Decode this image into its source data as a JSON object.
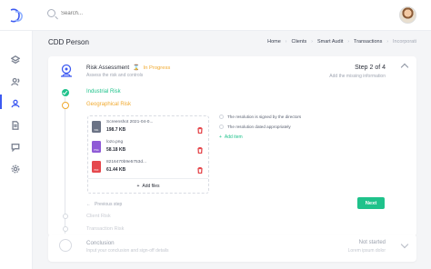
{
  "search": {
    "placeholder": "Search..."
  },
  "sidebar": {
    "items": [
      {
        "icon": "layers-icon"
      },
      {
        "icon": "users-icon"
      },
      {
        "icon": "user-icon",
        "active": true
      },
      {
        "icon": "document-icon"
      },
      {
        "icon": "chat-icon"
      },
      {
        "icon": "settings-icon"
      }
    ]
  },
  "header": {
    "title": "CDD Person",
    "breadcrumb": [
      "Home",
      "Clients",
      "Smart Audit",
      "Transactions",
      "Incorporati"
    ]
  },
  "risk": {
    "title": "Risk Assessment",
    "status": "In Progress",
    "subtitle": "Assess the risk and controls",
    "step_count": "Step 2 of 4",
    "step_desc": "Add the missing information"
  },
  "sections": {
    "done": "Industrial Risk",
    "current": "Geographical Risk",
    "pending": [
      "Client Risk",
      "Transaction Risk"
    ]
  },
  "files": [
    {
      "name": "Screenshot 2021-04-0...",
      "size": "198.7 KB",
      "type": "IMG",
      "color": "#6b7385"
    },
    {
      "name": "lozo.png",
      "size": "58.18 KB",
      "type": "PNG",
      "color": "#8f5bd6"
    },
    {
      "name": "8216470b9e5753d...",
      "size": "61.44 KB",
      "type": "PDF",
      "color": "#e5484d"
    }
  ],
  "add_files_label": "Add files",
  "checklist": [
    "The resolution is signed by the directors",
    "The resolution dated appropriately"
  ],
  "add_item_label": "Add item",
  "prev_step_label": "Previous step",
  "next_label": "Next",
  "conclusion": {
    "title": "Conclusion",
    "subtitle": "Input your conclusion and sign-off details",
    "status": "Not started",
    "desc": "Lorem ipsum dolor"
  },
  "colors": {
    "accent": "#1fc28b",
    "warning": "#f0a92e",
    "danger": "#e5484d",
    "nav_active": "#3d5af1"
  }
}
